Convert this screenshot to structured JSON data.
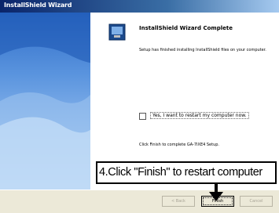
{
  "window": {
    "title": "InstallShield Wizard"
  },
  "main": {
    "heading": "InstallShield Wizard Complete",
    "message": "Setup has finished installing InstallShield files on your computer.",
    "restart_option": "Yes, I want to restart my computer now.",
    "finish_instruction": "Click Finish to complete GA-7IXE4 Setup."
  },
  "callout": {
    "text": "4.Click \"Finish\" to restart computer"
  },
  "buttons": {
    "back": "< Back",
    "finish": "Finish",
    "cancel": "Cancel"
  }
}
